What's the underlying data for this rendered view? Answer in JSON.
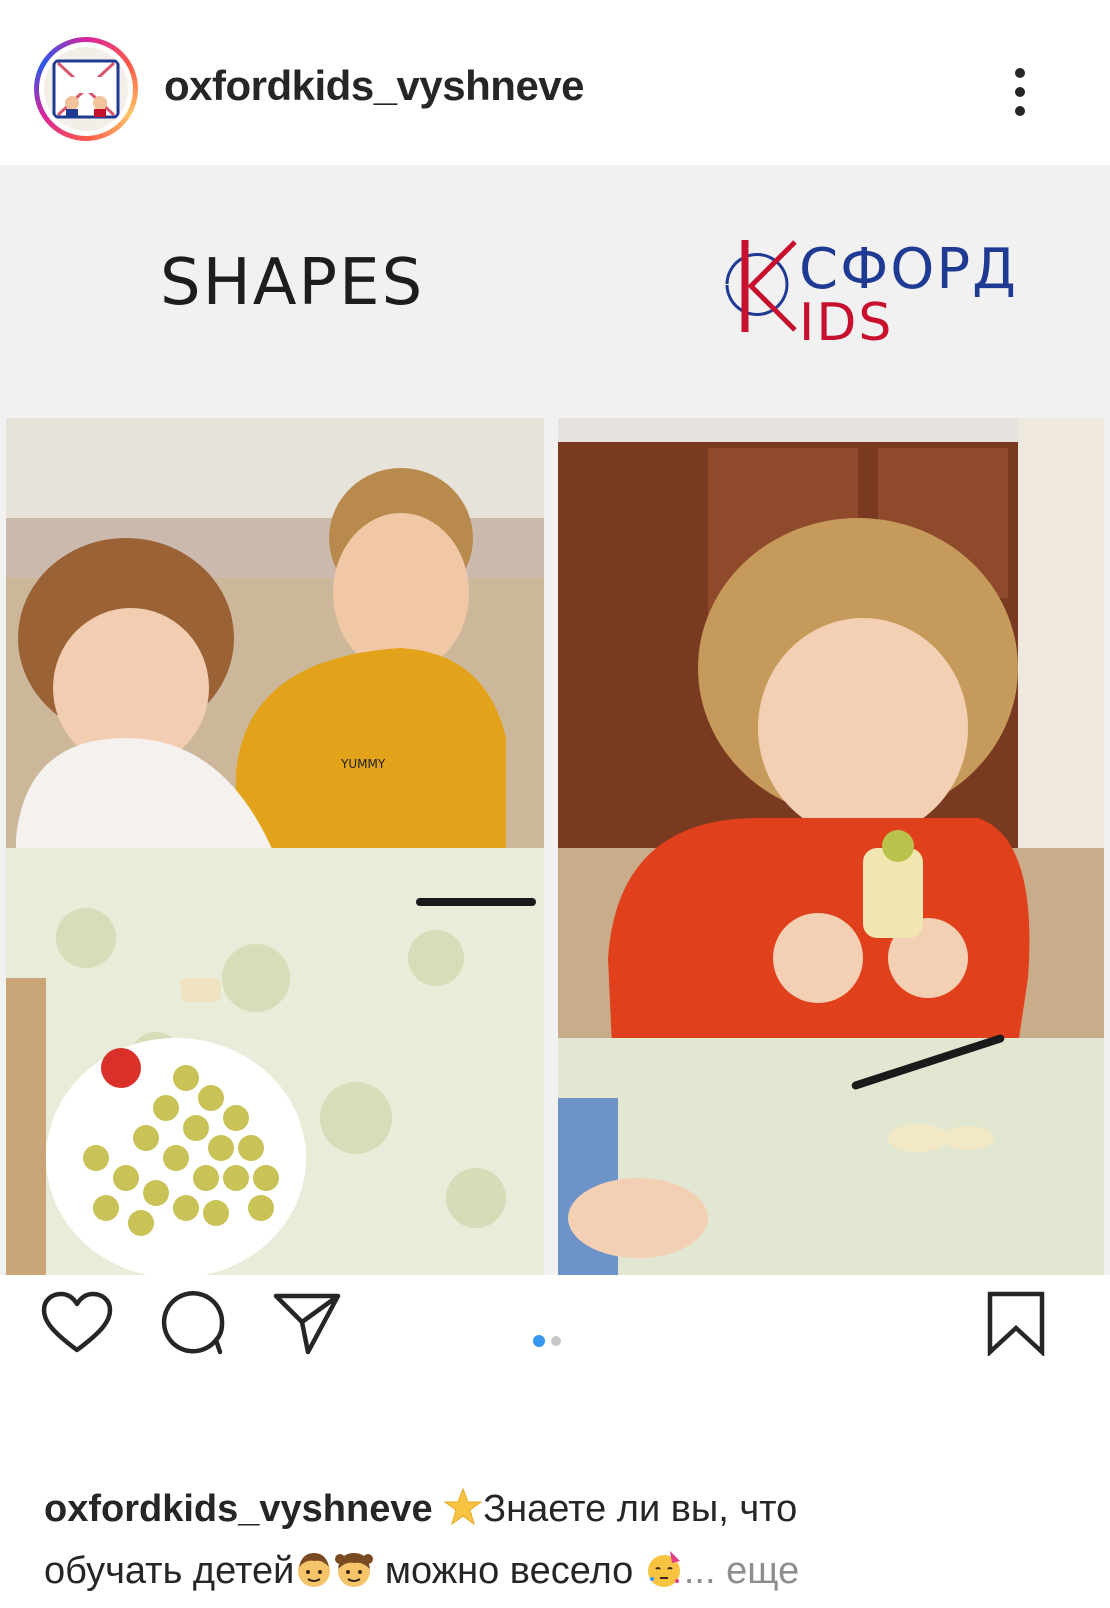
{
  "header": {
    "username": "oxfordkids_vyshneve",
    "avatar_logo_text": "ОКСФОРД KIDS",
    "more_icon": "more-vertical-icon"
  },
  "post": {
    "banner_title": "SHAPES",
    "brand_logo_text": "ОКСФОРД KIDS",
    "carousel": {
      "current": 1,
      "total": 2,
      "active_color": "#3897f0",
      "inactive_color": "#c7c7c7"
    }
  },
  "actions": {
    "like_icon": "heart-icon",
    "comment_icon": "comment-icon",
    "share_icon": "send-icon",
    "save_icon": "bookmark-icon"
  },
  "caption": {
    "username": "oxfordkids_vyshneve",
    "text_line1": "Знаете ли вы, что",
    "text_line2_a": "обучать детей",
    "text_line2_b": "можно весело",
    "more_label": "... еще",
    "emoji": [
      "star-emoji",
      "boy-emoji",
      "girl-emoji",
      "party-face-emoji"
    ]
  },
  "colors": {
    "brand_red": "#c8102e",
    "brand_blue": "#1f3a93",
    "text": "#262626",
    "muted": "#8e8e8e"
  }
}
